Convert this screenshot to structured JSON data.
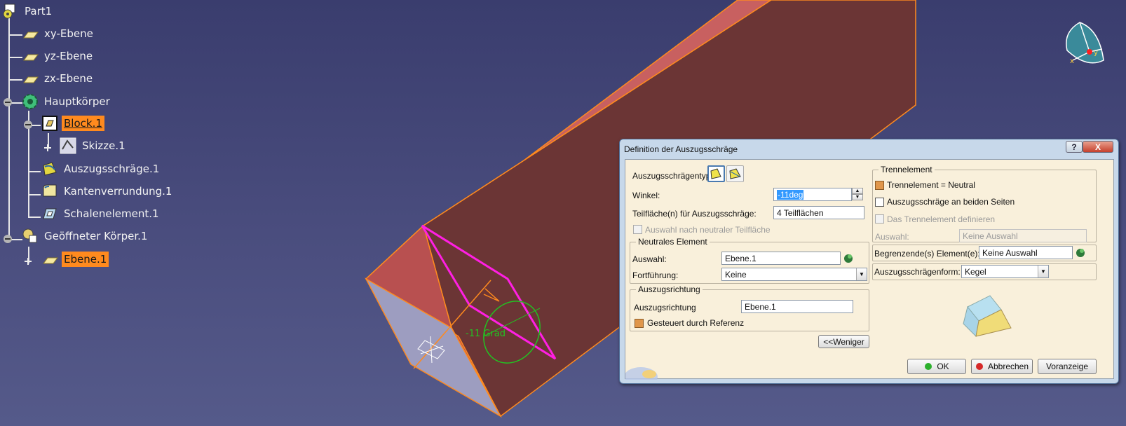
{
  "tree": {
    "root": "Part1",
    "xy_plane": "xy-Ebene",
    "yz_plane": "yz-Ebene",
    "zx_plane": "zx-Ebene",
    "main_body": "Hauptkörper",
    "pad": "Block.1",
    "sketch": "Skizze.1",
    "draft": "Auszugsschräge.1",
    "edge_fillet": "Kantenverrundung.1",
    "shell": "Schalenelement.1",
    "open_body": "Geöffneter Körper.1",
    "plane": "Ebene.1"
  },
  "viewport": {
    "angle_annotation": "-11 Grad",
    "compass_x": "x",
    "compass_y": "y"
  },
  "dialog": {
    "title": "Definition der Auszugsschräge",
    "help": "?",
    "close": "X",
    "draft_type_label": "Auszugsschrägentyp:",
    "angle_label": "Winkel:",
    "angle_value": "-11deg",
    "faces_label": "Teilfläche(n) für Auszugsschräge:",
    "faces_value": "4 Teilflächen",
    "select_neutral_label": "Auswahl nach neutraler Teilfläche",
    "neutral_group": "Neutrales Element",
    "neutral_selection_label": "Auswahl:",
    "neutral_selection_value": "Ebene.1",
    "propagation_label": "Fortführung:",
    "propagation_value": "Keine",
    "direction_group": "Auszugsrichtung",
    "direction_label": "Auszugsrichtung",
    "direction_value": "Ebene.1",
    "controlled_label": "Gesteuert durch Referenz",
    "less_button": "<<Weniger",
    "parting_group": "Trennelement",
    "parting_neutral_label": "Trennelement = Neutral",
    "both_sides_label": "Auszugsschräge an beiden Seiten",
    "define_parting_label": "Das Trennelement definieren",
    "parting_selection_label": "Auswahl:",
    "parting_selection_value": "Keine Auswahl",
    "limiting_label": "Begrenzende(s) Element(e):",
    "limiting_value": "Keine Auswahl",
    "form_label": "Auszugsschrägenform:",
    "form_value": "Kegel",
    "ok": "OK",
    "cancel": "Abbrechen",
    "preview": "Voranzeige"
  }
}
